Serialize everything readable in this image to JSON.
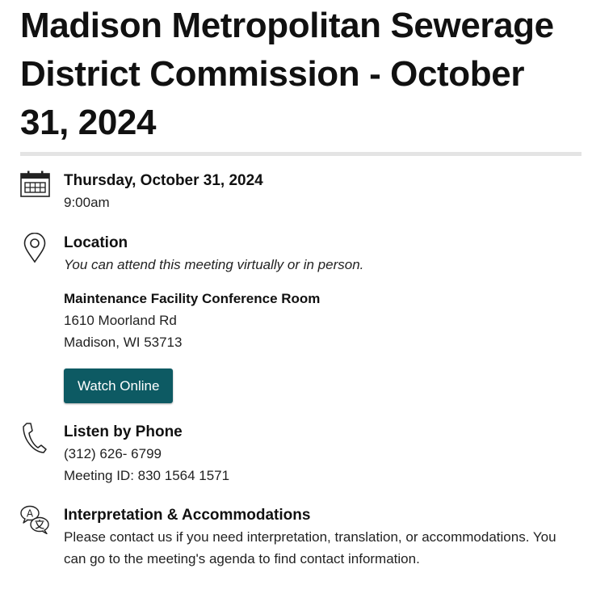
{
  "title": "Madison Metropolitan Sewerage District Commission - October 31, 2024",
  "date": {
    "icon": "calendar-icon",
    "heading": "Thursday, October 31, 2024",
    "time": "9:00am"
  },
  "location": {
    "icon": "map-pin-icon",
    "heading": "Location",
    "note": "You can attend this meeting virtually or in person.",
    "venue": "Maintenance Facility Conference Room",
    "street": "1610 Moorland Rd",
    "city": "Madison, WI 53713",
    "button_label": "Watch Online",
    "button_color": "#0d5a63"
  },
  "phone": {
    "icon": "phone-icon",
    "heading": "Listen by Phone",
    "number": "(312) 626- 6799",
    "meeting_id": "Meeting ID: 830 1564 1571"
  },
  "interpretation": {
    "icon": "translate-icon",
    "heading": "Interpretation & Accommodations",
    "text": "Please contact us if you need interpretation, translation, or accommodations. You can go to the meeting's agenda to find contact information."
  }
}
